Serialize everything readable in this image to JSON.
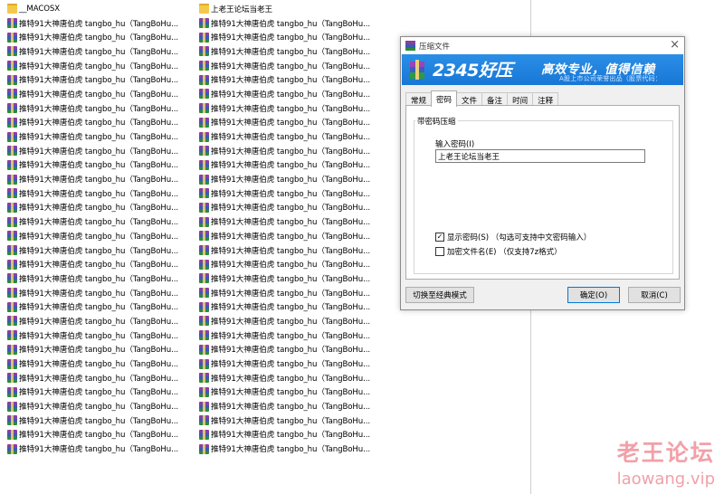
{
  "explorer": {
    "left_column": [
      {
        "name": "__MACOSX",
        "type": "folder"
      },
      {
        "name": "推特91大神唐伯虎 tangbo_hu（TangBoHu...",
        "type": "rar"
      },
      {
        "name": "推特91大神唐伯虎 tangbo_hu（TangBoHu...",
        "type": "rar"
      },
      {
        "name": "推特91大神唐伯虎 tangbo_hu（TangBoHu...",
        "type": "rar"
      },
      {
        "name": "推特91大神唐伯虎 tangbo_hu（TangBoHu...",
        "type": "rar"
      },
      {
        "name": "推特91大神唐伯虎 tangbo_hu（TangBoHu...",
        "type": "rar"
      },
      {
        "name": "推特91大神唐伯虎 tangbo_hu（TangBoHu...",
        "type": "rar"
      },
      {
        "name": "推特91大神唐伯虎 tangbo_hu（TangBoHu...",
        "type": "rar"
      },
      {
        "name": "推特91大神唐伯虎 tangbo_hu（TangBoHu...",
        "type": "rar"
      },
      {
        "name": "推特91大神唐伯虎 tangbo_hu（TangBoHu...",
        "type": "rar"
      },
      {
        "name": "推特91大神唐伯虎 tangbo_hu（TangBoHu...",
        "type": "rar"
      },
      {
        "name": "推特91大神唐伯虎 tangbo_hu（TangBoHu...",
        "type": "rar"
      },
      {
        "name": "推特91大神唐伯虎 tangbo_hu（TangBoHu...",
        "type": "rar"
      },
      {
        "name": "推特91大神唐伯虎 tangbo_hu（TangBoHu...",
        "type": "rar"
      },
      {
        "name": "推特91大神唐伯虎 tangbo_hu（TangBoHu...",
        "type": "rar"
      },
      {
        "name": "推特91大神唐伯虎 tangbo_hu（TangBoHu...",
        "type": "rar"
      },
      {
        "name": "推特91大神唐伯虎 tangbo_hu（TangBoHu...",
        "type": "rar"
      },
      {
        "name": "推特91大神唐伯虎 tangbo_hu（TangBoHu...",
        "type": "rar"
      },
      {
        "name": "推特91大神唐伯虎 tangbo_hu（TangBoHu...",
        "type": "rar"
      },
      {
        "name": "推特91大神唐伯虎 tangbo_hu（TangBoHu...",
        "type": "rar"
      },
      {
        "name": "推特91大神唐伯虎 tangbo_hu（TangBoHu...",
        "type": "rar"
      },
      {
        "name": "推特91大神唐伯虎 tangbo_hu（TangBoHu...",
        "type": "rar"
      },
      {
        "name": "推特91大神唐伯虎 tangbo_hu（TangBoHu...",
        "type": "rar"
      },
      {
        "name": "推特91大神唐伯虎 tangbo_hu（TangBoHu...",
        "type": "rar"
      },
      {
        "name": "推特91大神唐伯虎 tangbo_hu（TangBoHu...",
        "type": "rar"
      },
      {
        "name": "推特91大神唐伯虎 tangbo_hu（TangBoHu...",
        "type": "rar"
      },
      {
        "name": "推特91大神唐伯虎 tangbo_hu（TangBoHu...",
        "type": "rar"
      },
      {
        "name": "推特91大神唐伯虎 tangbo_hu（TangBoHu...",
        "type": "rar"
      },
      {
        "name": "推特91大神唐伯虎 tangbo_hu（TangBoHu...",
        "type": "rar"
      },
      {
        "name": "推特91大神唐伯虎 tangbo_hu（TangBoHu...",
        "type": "rar"
      },
      {
        "name": "推特91大神唐伯虎 tangbo_hu（TangBoHu...",
        "type": "rar"
      },
      {
        "name": "推特91大神唐伯虎 tangbo_hu（TangBoHu...",
        "type": "rar"
      }
    ],
    "right_column": [
      {
        "name": "上老王论坛当老王",
        "type": "folder"
      },
      {
        "name": "推特91大神唐伯虎 tangbo_hu（TangBoHu...",
        "type": "rar"
      },
      {
        "name": "推特91大神唐伯虎 tangbo_hu（TangBoHu...",
        "type": "rar"
      },
      {
        "name": "推特91大神唐伯虎 tangbo_hu（TangBoHu...",
        "type": "rar"
      },
      {
        "name": "推特91大神唐伯虎 tangbo_hu（TangBoHu...",
        "type": "rar"
      },
      {
        "name": "推特91大神唐伯虎 tangbo_hu（TangBoHu...",
        "type": "rar"
      },
      {
        "name": "推特91大神唐伯虎 tangbo_hu（TangBoHu...",
        "type": "rar"
      },
      {
        "name": "推特91大神唐伯虎 tangbo_hu（TangBoHu...",
        "type": "rar"
      },
      {
        "name": "推特91大神唐伯虎 tangbo_hu（TangBoHu...",
        "type": "rar"
      },
      {
        "name": "推特91大神唐伯虎 tangbo_hu（TangBoHu...",
        "type": "rar"
      },
      {
        "name": "推特91大神唐伯虎 tangbo_hu（TangBoHu...",
        "type": "rar"
      },
      {
        "name": "推特91大神唐伯虎 tangbo_hu（TangBoHu...",
        "type": "rar"
      },
      {
        "name": "推特91大神唐伯虎 tangbo_hu（TangBoHu...",
        "type": "rar"
      },
      {
        "name": "推特91大神唐伯虎 tangbo_hu（TangBoHu...",
        "type": "rar"
      },
      {
        "name": "推特91大神唐伯虎 tangbo_hu（TangBoHu...",
        "type": "rar"
      },
      {
        "name": "推特91大神唐伯虎 tangbo_hu（TangBoHu...",
        "type": "rar"
      },
      {
        "name": "推特91大神唐伯虎 tangbo_hu（TangBoHu...",
        "type": "rar"
      },
      {
        "name": "推特91大神唐伯虎 tangbo_hu（TangBoHu...",
        "type": "rar"
      },
      {
        "name": "推特91大神唐伯虎 tangbo_hu（TangBoHu...",
        "type": "rar"
      },
      {
        "name": "推特91大神唐伯虎 tangbo_hu（TangBoHu...",
        "type": "rar"
      },
      {
        "name": "推特91大神唐伯虎 tangbo_hu（TangBoHu...",
        "type": "rar"
      },
      {
        "name": "推特91大神唐伯虎 tangbo_hu（TangBoHu...",
        "type": "rar"
      },
      {
        "name": "推特91大神唐伯虎 tangbo_hu（TangBoHu...",
        "type": "rar"
      },
      {
        "name": "推特91大神唐伯虎 tangbo_hu（TangBoHu...",
        "type": "rar"
      },
      {
        "name": "推特91大神唐伯虎 tangbo_hu（TangBoHu...",
        "type": "rar"
      },
      {
        "name": "推特91大神唐伯虎 tangbo_hu（TangBoHu...",
        "type": "rar"
      },
      {
        "name": "推特91大神唐伯虎 tangbo_hu（TangBoHu...",
        "type": "rar"
      },
      {
        "name": "推特91大神唐伯虎 tangbo_hu（TangBoHu...",
        "type": "rar"
      },
      {
        "name": "推特91大神唐伯虎 tangbo_hu（TangBoHu...",
        "type": "rar"
      },
      {
        "name": "推特91大神唐伯虎 tangbo_hu（TangBoHu...",
        "type": "rar"
      },
      {
        "name": "推特91大神唐伯虎 tangbo_hu（TangBoHu...",
        "type": "rar"
      },
      {
        "name": "推特91大神唐伯虎 tangbo_hu（TangBoHu...",
        "type": "rar"
      }
    ]
  },
  "dialog": {
    "title": "压缩文件",
    "close_glyph": "×",
    "banner": {
      "brand": "2345好压",
      "slogan": "高效专业，值得信赖",
      "subtitle": "A股上市公司荣誉出品（股票代码：002195）"
    },
    "tabs": [
      "常规",
      "密码",
      "文件",
      "备注",
      "时间",
      "注释"
    ],
    "active_tab": "密码",
    "group_title": "带密码压缩",
    "password_label": "输入密码(I)",
    "password_value": "上老王论坛当老王",
    "show_password": {
      "label": "显示密码(S)  （勾选可支持中文密码输入）",
      "checked": true,
      "mark": "✓"
    },
    "encrypt_names": {
      "label": "加密文件名(E)  （仅支持7z格式）",
      "checked": false,
      "mark": ""
    },
    "buttons": {
      "switch_mode": "切换至经典模式",
      "ok": "确定(O)",
      "cancel": "取消(C)"
    }
  },
  "watermark": {
    "cn": "老王论坛",
    "en": "laowang.vip"
  },
  "colors": {
    "banner_blue": "#1e82dc",
    "folder_yellow": "#f4c94a",
    "watermark_pink": "#f2a0a8",
    "primary_border": "#0078d7"
  }
}
